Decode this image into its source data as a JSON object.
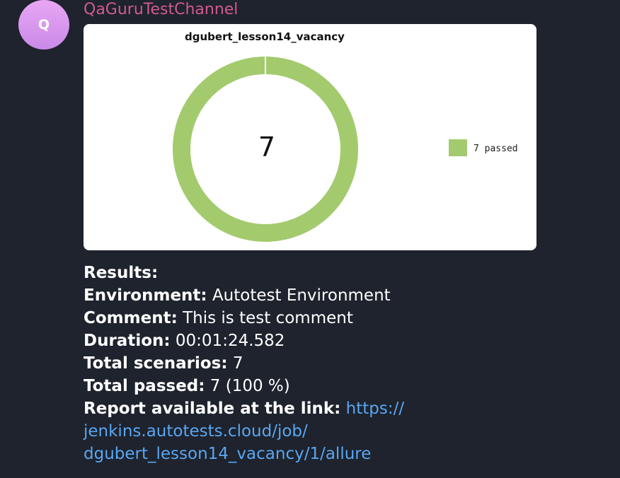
{
  "sender": {
    "avatar_letter": "Q",
    "name": "QaGuruTestChannel"
  },
  "chart_data": {
    "type": "pie",
    "title": "dgubert_lesson14_vacancy",
    "center_label": "7",
    "slices": [
      {
        "label": "7 passed",
        "value": 7,
        "color": "#a3cb6e"
      }
    ],
    "legend_position": "right"
  },
  "message": {
    "results_label": "Results:",
    "environment_label": "Environment:",
    "environment_value": "Autotest Environment",
    "comment_label": "Comment:",
    "comment_value": "This is test comment",
    "duration_label": "Duration:",
    "duration_value": "00:01:24.582",
    "total_scenarios_label": "Total scenarios:",
    "total_scenarios_value": "7",
    "total_passed_label": "Total passed:",
    "total_passed_value": "7 (100 %)",
    "report_label": "Report available at the link:",
    "report_link_line1": "https://",
    "report_link_line2": "jenkins.autotests.cloud/job/",
    "report_link_line3": "dgubert_lesson14_vacancy/1/allure"
  }
}
